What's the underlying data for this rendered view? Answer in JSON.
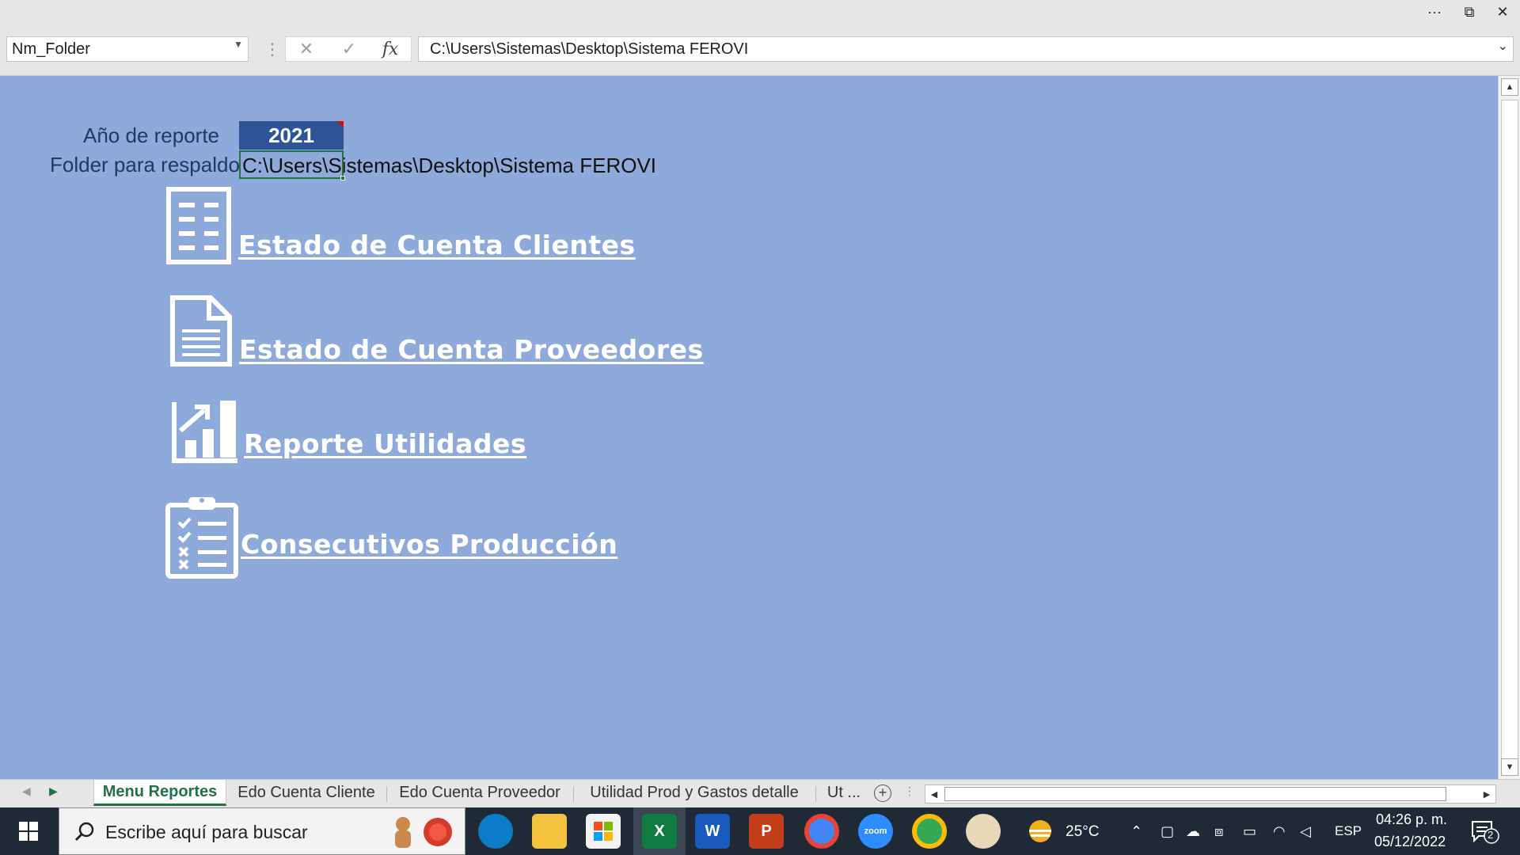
{
  "window": {
    "controls": {
      "more": "···",
      "restore": "⧉",
      "close": "✕"
    }
  },
  "formula_bar": {
    "name_box": "Nm_Folder",
    "cancel_glyph": "✕",
    "enter_glyph": "✓",
    "fx_label": "fx",
    "formula": "C:\\Users\\Sistemas\\Desktop\\Sistema FEROVI"
  },
  "sheet": {
    "year_label": "Año de reporte",
    "year_value": "2021",
    "folder_label": "Folder para respaldo",
    "folder_value": "C:\\Users\\Sistemas\\Desktop\\Sistema FEROVI",
    "reports": [
      {
        "label": "Estado de Cuenta Clientes",
        "icon": "list-document-icon"
      },
      {
        "label": "Estado de Cuenta Proveedores",
        "icon": "document-icon"
      },
      {
        "label": "Reporte Utilidades",
        "icon": "bar-chart-growth-icon"
      },
      {
        "label": "Consecutivos Producción",
        "icon": "clipboard-checklist-icon"
      }
    ]
  },
  "tabs": {
    "items": [
      "Menu Reportes",
      "Edo Cuenta Cliente",
      "Edo Cuenta Proveedor",
      "Utilidad Prod y Gastos detalle",
      "Ut ..."
    ],
    "active": "Menu Reportes",
    "add_glyph": "+"
  },
  "taskbar": {
    "search_placeholder": "Escribe aquí para buscar",
    "apps": [
      "edge",
      "file-explorer",
      "microsoft-store",
      "excel",
      "word",
      "powerpoint",
      "chrome",
      "zoom",
      "chrome-profile",
      "paint"
    ],
    "app_letters": {
      "excel": "X",
      "word": "W",
      "powerpoint": "P",
      "zoom": "zoom"
    },
    "weather": "25°C",
    "language": "ESP",
    "time": "04:26 p. m.",
    "date": "05/12/2022",
    "notifications": "2"
  },
  "colors": {
    "sheet_bg": "#8EAADB",
    "year_cell": "#2F5496",
    "label_text": "#1F3864",
    "excel_green": "#217346",
    "taskbar": "#1f2a36"
  }
}
